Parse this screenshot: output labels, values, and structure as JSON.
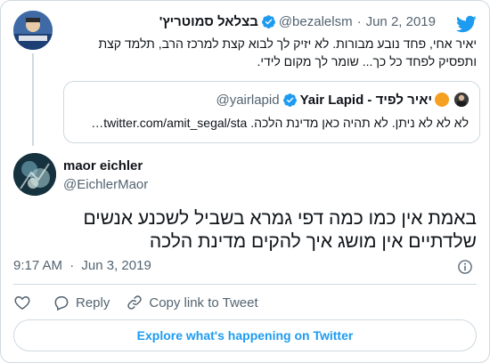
{
  "parent_tweet": {
    "author_name": "בצלאל סמוטריץ'",
    "handle": "@bezalelsm",
    "separator": "·",
    "date": "Jun 2, 2019",
    "text": "יאיר אחי, פחד נובע מבורות. לא יזיק לך לבוא קצת למרכז הרב, תלמד קצת ותפסיק לפחד כל כך... שומר לך מקום לידי."
  },
  "quoted_tweet": {
    "author_name": "Yair Lapid - יאיר לפיד",
    "handle": "@yairlapid",
    "text": "לא לא לא ניתן. לא תהיה כאן מדינת הלכה. twitter.com/amit_segal/sta…"
  },
  "main_tweet": {
    "author_name": "maor eichler",
    "handle": "@EichlerMaor",
    "text": "באמת אין כמו כמה דפי גמרא בשביל לשכנע אנשים שלדתיים אין מושג איך להקים מדינת הלכה",
    "time": "9:17 AM",
    "separator": "·",
    "date": "Jun 3, 2019"
  },
  "actions": {
    "reply_label": "Reply",
    "copy_link_label": "Copy link to Tweet"
  },
  "explore_label": "Explore what's happening on Twitter",
  "colors": {
    "twitter_blue": "#1d9bf0",
    "muted_text": "#536471",
    "border": "#cfd9de"
  },
  "icons": [
    "twitter-bird-icon",
    "verified-badge-icon",
    "orange-circle-icon",
    "info-icon",
    "heart-icon",
    "reply-icon",
    "link-icon"
  ]
}
